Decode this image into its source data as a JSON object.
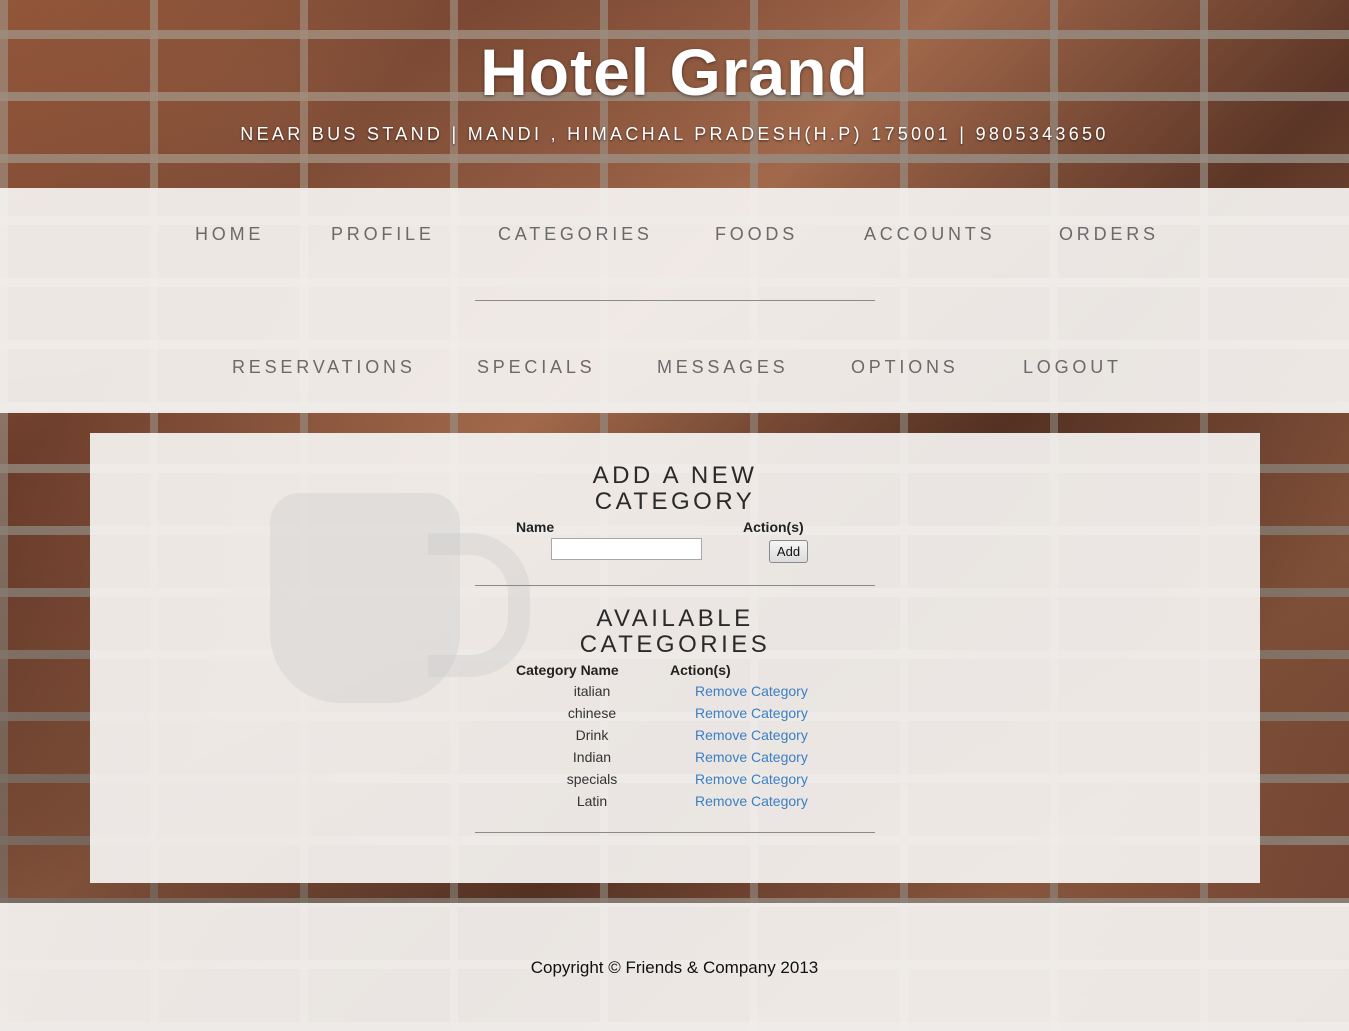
{
  "header": {
    "title": "Hotel Grand",
    "address": "NEAR BUS STAND | MANDI , HIMACHAL PRADESH(H.P) 175001 | 9805343650"
  },
  "nav": {
    "row1": [
      "HOME",
      "PROFILE",
      "CATEGORIES",
      "FOODS",
      "ACCOUNTS",
      "ORDERS"
    ],
    "row2": [
      "RESERVATIONS",
      "SPECIALS",
      "MESSAGES",
      "OPTIONS",
      "LOGOUT"
    ]
  },
  "add_form": {
    "title_line1": "ADD A NEW",
    "title_line2": "CATEGORY",
    "name_header": "Name",
    "action_header": "Action(s)",
    "name_value": "",
    "add_label": "Add"
  },
  "available": {
    "title_line1": "AVAILABLE",
    "title_line2": "CATEGORIES",
    "name_header": "Category Name",
    "action_header": "Action(s)",
    "rows": [
      {
        "name": "italian",
        "action": "Remove Category"
      },
      {
        "name": "chinese",
        "action": "Remove Category"
      },
      {
        "name": "Drink",
        "action": "Remove Category"
      },
      {
        "name": "Indian",
        "action": "Remove Category"
      },
      {
        "name": "specials",
        "action": "Remove Category"
      },
      {
        "name": "Latin",
        "action": "Remove Category"
      }
    ]
  },
  "footer": {
    "copyright": "Copyright © Friends & Company 2013"
  },
  "colors": {
    "link": "#3b7fc4",
    "nav_text": "#6a6a6a",
    "panel_bg": "#f5f3f1"
  }
}
